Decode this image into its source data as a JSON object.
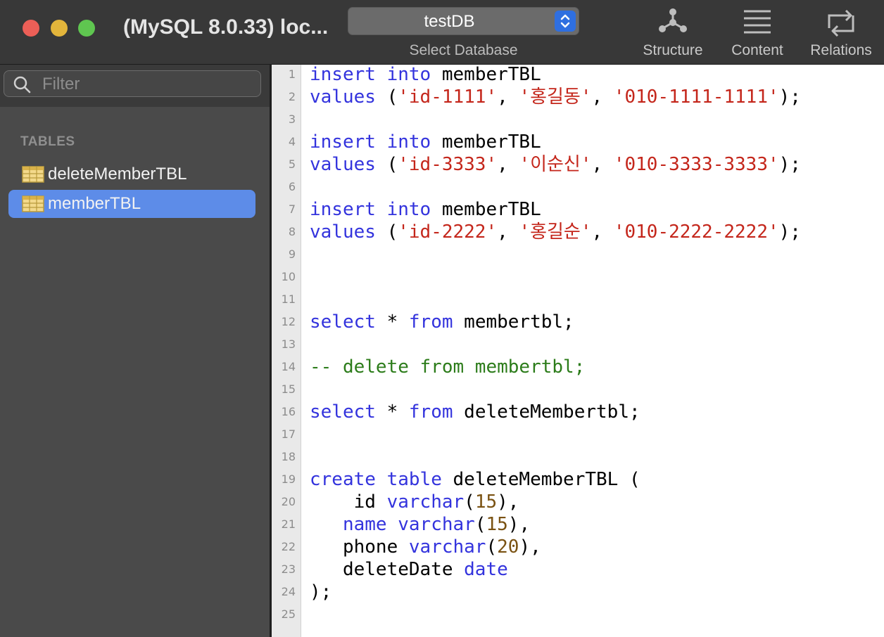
{
  "window": {
    "title": "(MySQL 8.0.33) loc..."
  },
  "toolbar": {
    "database_select": {
      "value": "testDB",
      "caption": "Select Database"
    },
    "buttons": [
      {
        "name": "structure",
        "label": "Structure",
        "icon": "structure-icon"
      },
      {
        "name": "content",
        "label": "Content",
        "icon": "content-icon"
      },
      {
        "name": "relations",
        "label": "Relations",
        "icon": "relations-icon"
      }
    ]
  },
  "sidebar": {
    "filter_placeholder": "Filter",
    "section_heading": "TABLES",
    "tables": [
      {
        "name": "deleteMemberTBL",
        "selected": false
      },
      {
        "name": "memberTBL",
        "selected": true
      }
    ]
  },
  "editor": {
    "line_numbers": [
      "1",
      "2",
      "3",
      "4",
      "5",
      "6",
      "7",
      "8",
      "9",
      "10",
      "11",
      "12",
      "13",
      "14",
      "15",
      "16",
      "17",
      "18",
      "19",
      "20",
      "21",
      "22",
      "23",
      "24",
      "25"
    ],
    "lines": [
      [
        {
          "t": "kw",
          "v": "insert"
        },
        {
          "t": "plain",
          "v": " "
        },
        {
          "t": "kw",
          "v": "into"
        },
        {
          "t": "plain",
          "v": " memberTBL"
        }
      ],
      [
        {
          "t": "kw",
          "v": "values"
        },
        {
          "t": "plain",
          "v": " ("
        },
        {
          "t": "str",
          "v": "'id-1111'"
        },
        {
          "t": "plain",
          "v": ", "
        },
        {
          "t": "str",
          "v": "'홍길동'"
        },
        {
          "t": "plain",
          "v": ", "
        },
        {
          "t": "str",
          "v": "'010-1111-1111'"
        },
        {
          "t": "plain",
          "v": ");"
        }
      ],
      [],
      [
        {
          "t": "kw",
          "v": "insert"
        },
        {
          "t": "plain",
          "v": " "
        },
        {
          "t": "kw",
          "v": "into"
        },
        {
          "t": "plain",
          "v": " memberTBL"
        }
      ],
      [
        {
          "t": "kw",
          "v": "values"
        },
        {
          "t": "plain",
          "v": " ("
        },
        {
          "t": "str",
          "v": "'id-3333'"
        },
        {
          "t": "plain",
          "v": ", "
        },
        {
          "t": "str",
          "v": "'이순신'"
        },
        {
          "t": "plain",
          "v": ", "
        },
        {
          "t": "str",
          "v": "'010-3333-3333'"
        },
        {
          "t": "plain",
          "v": ");"
        }
      ],
      [],
      [
        {
          "t": "kw",
          "v": "insert"
        },
        {
          "t": "plain",
          "v": " "
        },
        {
          "t": "kw",
          "v": "into"
        },
        {
          "t": "plain",
          "v": " memberTBL"
        }
      ],
      [
        {
          "t": "kw",
          "v": "values"
        },
        {
          "t": "plain",
          "v": " ("
        },
        {
          "t": "str",
          "v": "'id-2222'"
        },
        {
          "t": "plain",
          "v": ", "
        },
        {
          "t": "str",
          "v": "'홍길순'"
        },
        {
          "t": "plain",
          "v": ", "
        },
        {
          "t": "str",
          "v": "'010-2222-2222'"
        },
        {
          "t": "plain",
          "v": ");"
        }
      ],
      [],
      [],
      [],
      [
        {
          "t": "kw",
          "v": "select"
        },
        {
          "t": "plain",
          "v": " * "
        },
        {
          "t": "kw",
          "v": "from"
        },
        {
          "t": "plain",
          "v": " membertbl;"
        }
      ],
      [],
      [
        {
          "t": "cmt",
          "v": "-- delete from membertbl;"
        }
      ],
      [],
      [
        {
          "t": "kw",
          "v": "select"
        },
        {
          "t": "plain",
          "v": " * "
        },
        {
          "t": "kw",
          "v": "from"
        },
        {
          "t": "plain",
          "v": " deleteMembertbl;"
        }
      ],
      [],
      [],
      [
        {
          "t": "kw",
          "v": "create"
        },
        {
          "t": "plain",
          "v": " "
        },
        {
          "t": "kw",
          "v": "table"
        },
        {
          "t": "plain",
          "v": " deleteMemberTBL ("
        }
      ],
      [
        {
          "t": "plain",
          "v": "    id "
        },
        {
          "t": "kw",
          "v": "varchar"
        },
        {
          "t": "plain",
          "v": "("
        },
        {
          "t": "num",
          "v": "15"
        },
        {
          "t": "plain",
          "v": "),"
        }
      ],
      [
        {
          "t": "plain",
          "v": "   "
        },
        {
          "t": "kw",
          "v": "name"
        },
        {
          "t": "plain",
          "v": " "
        },
        {
          "t": "kw",
          "v": "varchar"
        },
        {
          "t": "plain",
          "v": "("
        },
        {
          "t": "num",
          "v": "15"
        },
        {
          "t": "plain",
          "v": "),"
        }
      ],
      [
        {
          "t": "plain",
          "v": "   phone "
        },
        {
          "t": "kw",
          "v": "varchar"
        },
        {
          "t": "plain",
          "v": "("
        },
        {
          "t": "num",
          "v": "20"
        },
        {
          "t": "plain",
          "v": "),"
        }
      ],
      [
        {
          "t": "plain",
          "v": "   deleteDate "
        },
        {
          "t": "kw",
          "v": "date"
        }
      ],
      [
        {
          "t": "plain",
          "v": ");"
        }
      ],
      []
    ]
  },
  "colors": {
    "keyword": "#3333dd",
    "string": "#c4261b",
    "number": "#7a5212",
    "comment": "#2c7c1a",
    "selection": "#5d8ce8"
  }
}
